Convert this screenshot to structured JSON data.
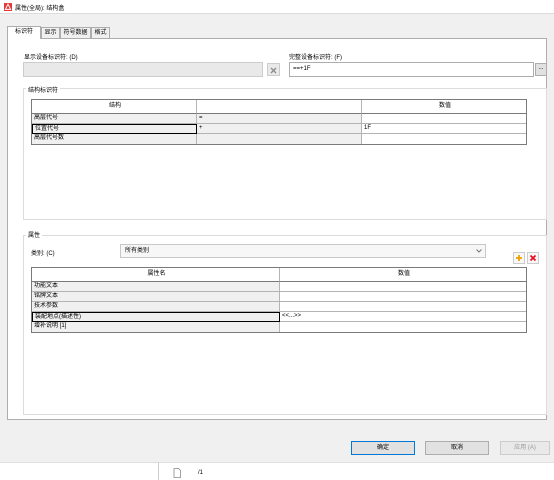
{
  "window": {
    "title": "属性(全局): 结构盒"
  },
  "tabs": [
    {
      "label": "标识符",
      "active": true
    },
    {
      "label": "显示",
      "active": false
    },
    {
      "label": "符号数据",
      "active": false
    },
    {
      "label": "格式",
      "active": false
    }
  ],
  "display_id": {
    "label": "显示设备标识符: (D)",
    "value": ""
  },
  "full_id": {
    "label": "完整设备标识符: (F)",
    "value": "==+1F",
    "browse_label": "..."
  },
  "structure": {
    "section_title": "结构标识符",
    "headers": [
      "结构",
      "",
      "数值"
    ],
    "rows": [
      {
        "name": "高层代号",
        "prefix": "=",
        "value": ""
      },
      {
        "name": "位置代号",
        "prefix": "+",
        "value": "1F"
      },
      {
        "name": "高层代号数",
        "prefix": "",
        "value": ""
      }
    ]
  },
  "properties": {
    "section_title": "属性",
    "category_label": "类别: (C)",
    "category_value": "所有类别",
    "headers": [
      "属性名",
      "数值"
    ],
    "rows": [
      {
        "name": "功能文本",
        "value": ""
      },
      {
        "name": "铭牌文本",
        "value": ""
      },
      {
        "name": "技术参数",
        "value": ""
      },
      {
        "name": "装配地点(描述性)",
        "value": "<<...>>"
      },
      {
        "name": "增补说明 [1]",
        "value": ""
      }
    ]
  },
  "buttons": {
    "ok": "确定",
    "cancel": "取消",
    "apply": "应用 (A)"
  },
  "footer": {
    "path_text": "/1"
  },
  "colors": {
    "accent": "#0078d7",
    "delete": "#e81123",
    "add": "#f0a000",
    "app_icon": "#e53935"
  }
}
